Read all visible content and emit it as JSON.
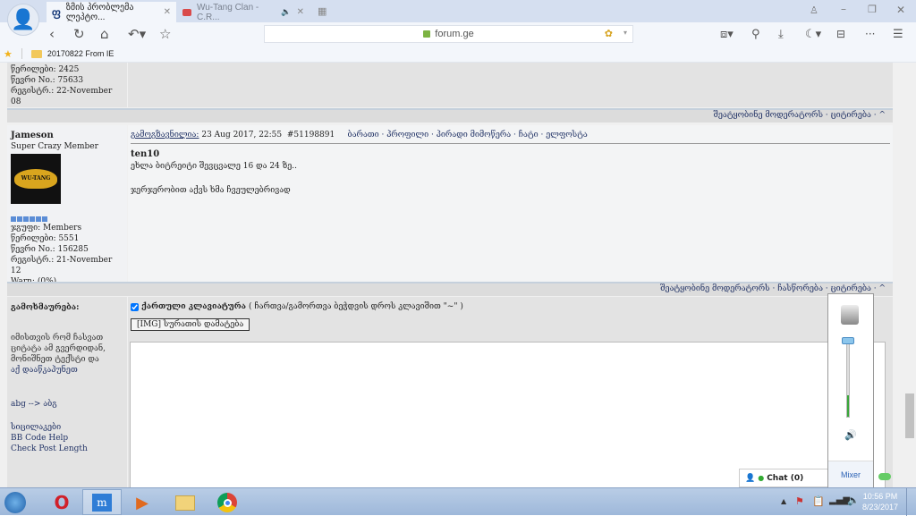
{
  "browser": {
    "tabs": [
      {
        "label": "ზმის პრობლემა ლეპტო...",
        "favicon": "forum-icon"
      },
      {
        "label": "Wu-Tang Clan - C.R...",
        "favicon": "youtube-icon",
        "audio": "speaker-icon"
      }
    ],
    "url": "forum.ge",
    "bookmark": "20170822 From IE"
  },
  "prev_post": {
    "stats": [
      "წერილები: 2425",
      "წევრი No.: 75633",
      "რეგისტრ.: 22-November 08"
    ],
    "actions": "შეატყობინე მოდერატორს · ციტირება · ^"
  },
  "post": {
    "author": "Jameson",
    "rank": "Super Crazy Member",
    "avatar_text": "WU-TANG",
    "stats": [
      "ჯგუფი: Members",
      "წერილები: 5551",
      "წევრი No.: 156285",
      "რეგისტრ.: 21-November 12",
      "Warn: (0%)"
    ],
    "sent_label": "გამოგზავნილია:",
    "date": "23 Aug 2017, 22:55",
    "post_id": "#51198891",
    "links": "ბარათი · პროფილი · პირადი მიმოწერა · ჩატი · ელფოსტა",
    "title": "ten10",
    "lines": [
      "ეხლა ბიტრეიტი შევცვალე 16 და 24 ზე..",
      "ჯერჯერობით აქვს ხმა ჩვეულებრივად"
    ],
    "actions": "შეატყობინე მოდერატორს · ჩასწორება · ციტირება · ^"
  },
  "reply": {
    "label": "გამოხმაურება:",
    "hint": "იმისთვის რომ ჩასვათ ციტატა ამ გვერდიდან, მონიშნეთ ტექსტი და",
    "hint_link": "აქ დააწკაპუნეთ",
    "translit": "abg --> აბგ",
    "smilies": "სიცილაკები",
    "bbcode": "BB Code Help",
    "check": "Check Post Length",
    "keyboard_label": "ქართული კლავიატურა",
    "keyboard_checked": true,
    "keyboard_note": "( ჩართვა/გამორთვა ბეჭდვის დროს კლავიშით \"~\" )",
    "img_button": "[IMG] სურათის დამატება",
    "textarea_value": ""
  },
  "volume": {
    "level": 0.3,
    "mixer": "Mixer"
  },
  "chat": {
    "label": "Chat (0)"
  },
  "taskbar": {
    "time": "10:56 PM",
    "date": "8/23/2017"
  }
}
